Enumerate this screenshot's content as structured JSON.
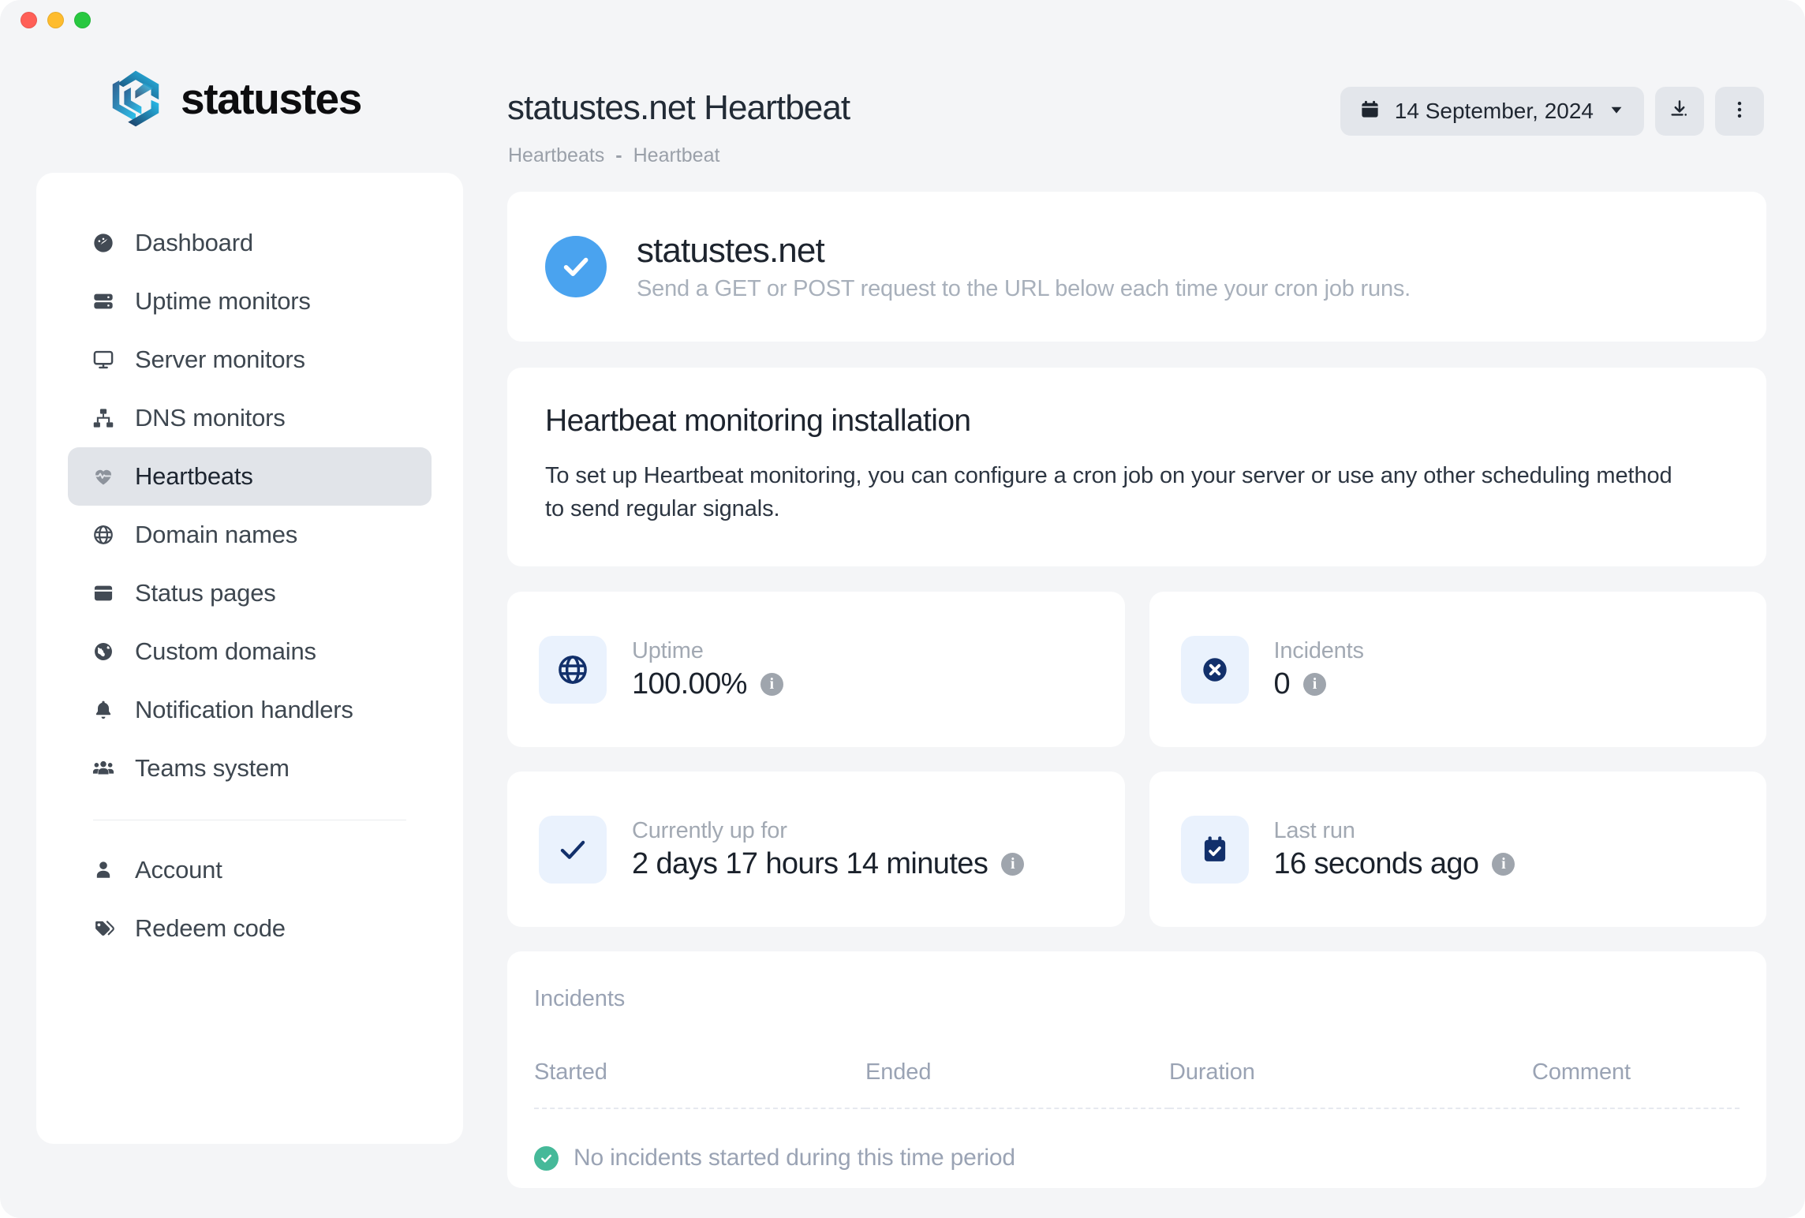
{
  "window": {
    "traffic_lights": [
      {
        "name": "close",
        "color": "#ff5f57"
      },
      {
        "name": "minimize",
        "color": "#febc2e"
      },
      {
        "name": "maximize",
        "color": "#28c840"
      }
    ]
  },
  "brand": {
    "name": "statustes"
  },
  "sidebar": {
    "items": [
      {
        "label": "Dashboard",
        "icon": "gauge-icon",
        "active": false
      },
      {
        "label": "Uptime monitors",
        "icon": "server-icon",
        "active": false
      },
      {
        "label": "Server monitors",
        "icon": "monitor-icon",
        "active": false
      },
      {
        "label": "DNS monitors",
        "icon": "sitemap-icon",
        "active": false
      },
      {
        "label": "Heartbeats",
        "icon": "heart-pulse-icon",
        "active": true
      },
      {
        "label": "Domain names",
        "icon": "globe-icon",
        "active": false
      },
      {
        "label": "Status pages",
        "icon": "window-icon",
        "active": false
      },
      {
        "label": "Custom domains",
        "icon": "earth-icon",
        "active": false
      },
      {
        "label": "Notification handlers",
        "icon": "bell-icon",
        "active": false
      },
      {
        "label": "Teams system",
        "icon": "users-icon",
        "active": false
      }
    ],
    "footer_items": [
      {
        "label": "Account",
        "icon": "user-icon"
      },
      {
        "label": "Redeem code",
        "icon": "tag-icon"
      }
    ]
  },
  "header": {
    "title": "statustes.net Heartbeat",
    "breadcrumb": {
      "parent": "Heartbeats",
      "separator": "-",
      "current": "Heartbeat"
    },
    "date_picker": {
      "value": "14 September, 2024",
      "icon": "calendar-icon",
      "chevron": "chevron-down-icon"
    },
    "download_button": {
      "icon": "download-icon"
    },
    "more_button": {
      "icon": "kebab-menu-icon"
    }
  },
  "hero": {
    "status_icon": "check-circle-icon",
    "status_color": "#4aa3ef",
    "title": "statustes.net",
    "subtitle": "Send a GET or POST request to the URL below each time your cron job runs."
  },
  "install": {
    "heading": "Heartbeat monitoring installation",
    "body": "To set up Heartbeat monitoring, you can configure a cron job on your server or use any other scheduling method to send regular signals."
  },
  "stats": [
    {
      "label": "Uptime",
      "value": "100.00%",
      "icon": "globe-icon",
      "info": "i"
    },
    {
      "label": "Incidents",
      "value": "0",
      "icon": "x-circle-icon",
      "info": "i"
    },
    {
      "label": "Currently up for",
      "value": "2 days 17 hours 14 minutes",
      "icon": "check-icon",
      "info": "i"
    },
    {
      "label": "Last run",
      "value": "16 seconds ago",
      "icon": "calendar-check-icon",
      "info": "i"
    }
  ],
  "incidents": {
    "heading": "Incidents",
    "columns": [
      "Started",
      "Ended",
      "Duration",
      "Comment"
    ],
    "empty_message": "No incidents started during this time period",
    "empty_icon": "check-circle-icon",
    "empty_icon_color": "#46b999"
  },
  "colors": {
    "page_background": "#f4f5f7",
    "card_background": "#ffffff",
    "accent_blue": "#4aa3ef",
    "icon_navy": "#12306b",
    "tile_blue": "#eaf2fd",
    "active_nav": "#e1e4e9",
    "muted_text": "#9aa3b4"
  }
}
